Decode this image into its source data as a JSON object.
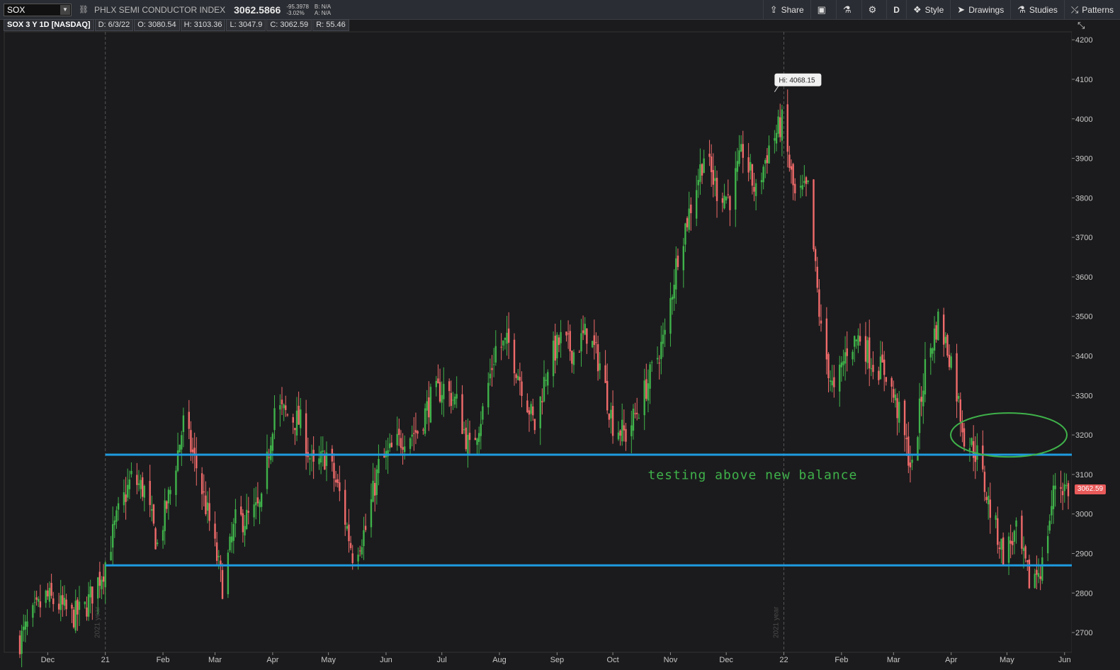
{
  "toolbar": {
    "symbol": "SOX",
    "description": "PHLX SEMI CONDUCTOR INDEX",
    "last_price": "3062.5866",
    "net_change": "-95.3978",
    "pct_change": "-3.02%",
    "bid": "B: N/A",
    "ask": "A: N/A",
    "buttons": {
      "share": "Share",
      "aggregation": "D",
      "style": "Style",
      "drawings": "Drawings",
      "studies": "Studies",
      "patterns": "Patterns"
    },
    "icons": [
      "dropdown-arrow-icon",
      "link-icon",
      "share-icon",
      "snapshot-icon",
      "flask-icon",
      "gear-icon",
      "style-icon",
      "cursor-icon",
      "studies-icon",
      "patterns-icon",
      "expand-icon",
      "alert-icon"
    ]
  },
  "infobar": {
    "title": "SOX 3 Y 1D [NASDAQ]",
    "date": "D: 6/3/22",
    "open": "O: 3080.54",
    "high": "H: 3103.36",
    "low": "L: 3047.9",
    "close": "C: 3062.59",
    "range": "R: 55.46"
  },
  "colors": {
    "up": "#3fb24a",
    "down": "#f06a6a",
    "level": "#1e9be0",
    "annotation": "#3fb24a",
    "background": "#1b1b1d"
  },
  "chart_data": {
    "type": "candlestick",
    "ylim": [
      2650,
      4220
    ],
    "y_ticks": [
      2700,
      2800,
      2900,
      3000,
      3100,
      3200,
      3300,
      3400,
      3500,
      3600,
      3700,
      3800,
      3900,
      4000,
      4100,
      4200
    ],
    "x_tick_labels": [
      {
        "label": "Dec",
        "date": "2020-12-01"
      },
      {
        "label": "21",
        "date": "2021-01-01"
      },
      {
        "label": "Feb",
        "date": "2021-02-01"
      },
      {
        "label": "Mar",
        "date": "2021-03-01"
      },
      {
        "label": "Apr",
        "date": "2021-04-01"
      },
      {
        "label": "May",
        "date": "2021-05-01"
      },
      {
        "label": "Jun",
        "date": "2021-06-01"
      },
      {
        "label": "Jul",
        "date": "2021-07-01"
      },
      {
        "label": "Aug",
        "date": "2021-08-01"
      },
      {
        "label": "Sep",
        "date": "2021-09-01"
      },
      {
        "label": "Oct",
        "date": "2021-10-01"
      },
      {
        "label": "Nov",
        "date": "2021-11-01"
      },
      {
        "label": "Dec",
        "date": "2021-12-01"
      },
      {
        "label": "22",
        "date": "2022-01-01"
      },
      {
        "label": "Feb",
        "date": "2022-02-01"
      },
      {
        "label": "Mar",
        "date": "2022-03-01"
      },
      {
        "label": "Apr",
        "date": "2022-04-01"
      },
      {
        "label": "May",
        "date": "2022-05-01"
      },
      {
        "label": "Jun",
        "date": "2022-06-01"
      }
    ],
    "year_markers": [
      {
        "label": "2021 year",
        "date": "2021-01-01"
      },
      {
        "label": "2021 year",
        "date": "2022-01-01"
      }
    ],
    "close_path": [
      [
        "2020-11-16",
        2680
      ],
      [
        "2020-11-23",
        2740
      ],
      [
        "2020-11-30",
        2790
      ],
      [
        "2020-12-07",
        2770
      ],
      [
        "2020-12-14",
        2740
      ],
      [
        "2020-12-21",
        2760
      ],
      [
        "2020-12-31",
        2860
      ],
      [
        "2021-01-08",
        3000
      ],
      [
        "2021-01-15",
        3090
      ],
      [
        "2021-01-22",
        3060
      ],
      [
        "2021-01-29",
        2920
      ],
      [
        "2021-02-05",
        3060
      ],
      [
        "2021-02-12",
        3230
      ],
      [
        "2021-02-19",
        3120
      ],
      [
        "2021-02-26",
        2980
      ],
      [
        "2021-03-05",
        2820
      ],
      [
        "2021-03-12",
        2980
      ],
      [
        "2021-03-19",
        2990
      ],
      [
        "2021-03-26",
        3020
      ],
      [
        "2021-04-02",
        3270
      ],
      [
        "2021-04-09",
        3250
      ],
      [
        "2021-04-16",
        3230
      ],
      [
        "2021-04-23",
        3110
      ],
      [
        "2021-04-30",
        3150
      ],
      [
        "2021-05-07",
        3050
      ],
      [
        "2021-05-14",
        2900
      ],
      [
        "2021-05-21",
        2960
      ],
      [
        "2021-05-28",
        3120
      ],
      [
        "2021-06-04",
        3160
      ],
      [
        "2021-06-11",
        3200
      ],
      [
        "2021-06-18",
        3210
      ],
      [
        "2021-06-25",
        3290
      ],
      [
        "2021-07-02",
        3320
      ],
      [
        "2021-07-09",
        3280
      ],
      [
        "2021-07-16",
        3160
      ],
      [
        "2021-07-23",
        3260
      ],
      [
        "2021-07-30",
        3420
      ],
      [
        "2021-08-06",
        3430
      ],
      [
        "2021-08-13",
        3330
      ],
      [
        "2021-08-20",
        3220
      ],
      [
        "2021-08-27",
        3380
      ],
      [
        "2021-09-03",
        3440
      ],
      [
        "2021-09-10",
        3410
      ],
      [
        "2021-09-17",
        3460
      ],
      [
        "2021-09-24",
        3380
      ],
      [
        "2021-10-01",
        3230
      ],
      [
        "2021-10-08",
        3200
      ],
      [
        "2021-10-15",
        3270
      ],
      [
        "2021-10-22",
        3360
      ],
      [
        "2021-10-29",
        3450
      ],
      [
        "2021-11-05",
        3660
      ],
      [
        "2021-11-12",
        3780
      ],
      [
        "2021-11-19",
        3910
      ],
      [
        "2021-11-26",
        3820
      ],
      [
        "2021-12-03",
        3800
      ],
      [
        "2021-12-10",
        3920
      ],
      [
        "2021-12-17",
        3810
      ],
      [
        "2021-12-24",
        3930
      ],
      [
        "2021-12-31",
        3990
      ],
      [
        "2022-01-07",
        3800
      ],
      [
        "2022-01-14",
        3820
      ],
      [
        "2022-01-21",
        3460
      ],
      [
        "2022-01-28",
        3300
      ],
      [
        "2022-02-04",
        3420
      ],
      [
        "2022-02-11",
        3450
      ],
      [
        "2022-02-18",
        3380
      ],
      [
        "2022-02-25",
        3360
      ],
      [
        "2022-03-04",
        3250
      ],
      [
        "2022-03-11",
        3110
      ],
      [
        "2022-03-18",
        3370
      ],
      [
        "2022-03-25",
        3490
      ],
      [
        "2022-04-01",
        3390
      ],
      [
        "2022-04-08",
        3200
      ],
      [
        "2022-04-15",
        3150
      ],
      [
        "2022-04-22",
        3010
      ],
      [
        "2022-04-29",
        2900
      ],
      [
        "2022-05-06",
        2950
      ],
      [
        "2022-05-13",
        2830
      ],
      [
        "2022-05-20",
        2870
      ],
      [
        "2022-05-27",
        3080
      ],
      [
        "2022-06-03",
        3062.59
      ]
    ],
    "high_marker": {
      "label": "Hi: 4068.15",
      "date": "2021-12-27",
      "value": 4068.15
    },
    "horizontal_levels": [
      3150,
      2870
    ],
    "annotation": {
      "text": "testing above new balance",
      "date": "2021-11-01",
      "value": 3095
    },
    "ellipse": {
      "date": "2022-05-02",
      "value": 3200
    },
    "last_price_label": "3062.59",
    "last_price_value": 3062.59
  }
}
